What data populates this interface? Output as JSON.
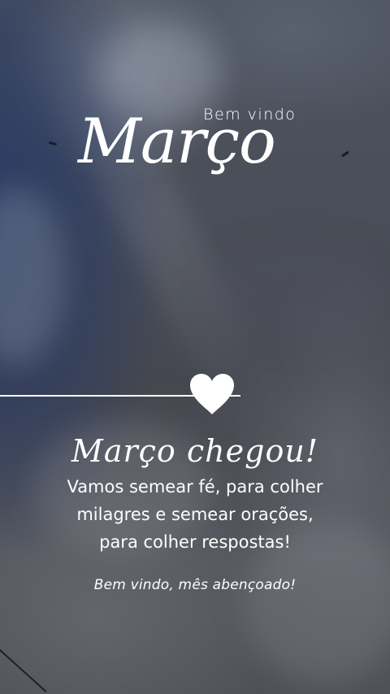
{
  "header": {
    "subtitle": "Bem vindo",
    "title": "Março"
  },
  "divider": {
    "icon": "heart-icon",
    "color": "#ffffff"
  },
  "message": {
    "headline": "Março chegou!",
    "lines": [
      "Vamos semear fé, para colher",
      "milagres e semear orações,",
      "para colher respostas!"
    ],
    "closing": "Bem vindo, mês abençoado!"
  },
  "colors": {
    "text": "#ffffff",
    "sky_dark": "#3a3d45",
    "sky_blue": "#283a64"
  }
}
